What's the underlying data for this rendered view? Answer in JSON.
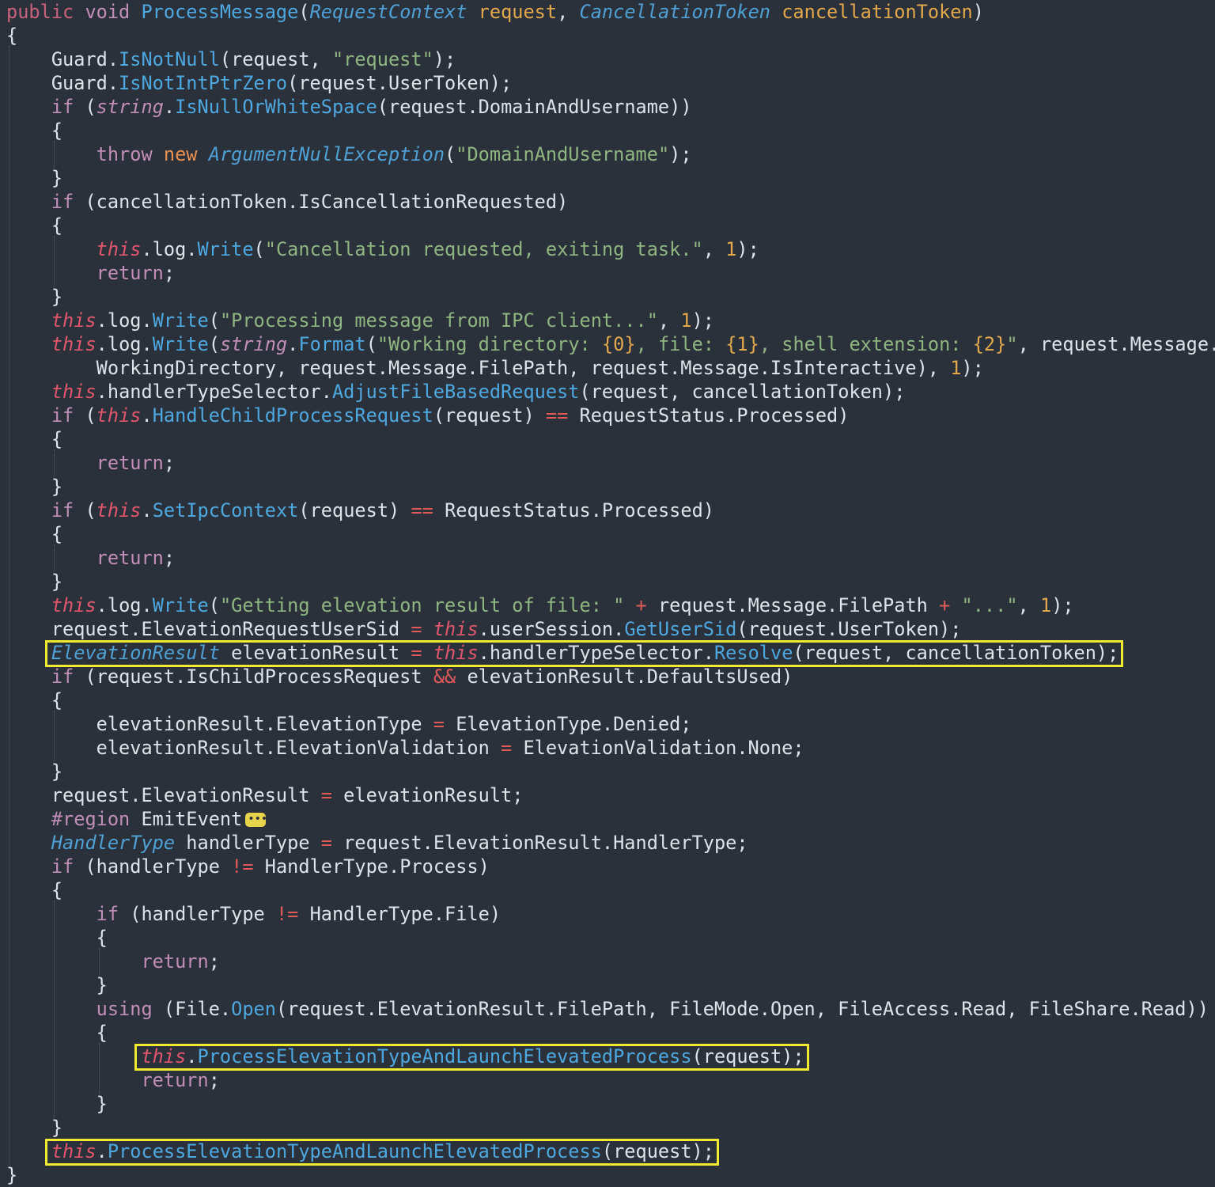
{
  "colors": {
    "background": "#2b313b",
    "text": "#dfe3e8",
    "keyword": "#c18eb8",
    "keyword_modifier": "#c9627a",
    "keyword_new": "#e89150",
    "type": "#4fa0d4",
    "method": "#4ea8e0",
    "string": "#8fb580",
    "number": "#e2a84c",
    "this": "#e0566c",
    "operator": "#e05a5a",
    "param": "#e2a84c",
    "highlight": "#f2ea2f"
  },
  "code_lines": [
    [
      [
        "public ",
        "keyword_modifier"
      ],
      [
        "void ",
        "keyword"
      ],
      [
        "ProcessMessage",
        "method"
      ],
      [
        "(",
        "text"
      ],
      [
        "RequestContext",
        "type_it"
      ],
      [
        " request, ",
        "param_mix"
      ],
      [
        "CancellationToken",
        "type_it"
      ],
      [
        " cancellationToken",
        "param"
      ],
      [
        ")",
        "text"
      ]
    ],
    [
      [
        "{",
        "text"
      ]
    ],
    [
      [
        "    Guard.",
        "text"
      ],
      [
        "IsNotNull",
        "method"
      ],
      [
        "(request, ",
        "text"
      ],
      [
        "\"request\"",
        "string"
      ],
      [
        ");",
        "text"
      ]
    ],
    [
      [
        "    Guard.",
        "text"
      ],
      [
        "IsNotIntPtrZero",
        "method"
      ],
      [
        "(request.UserToken);",
        "text"
      ]
    ],
    [
      [
        "    ",
        "text"
      ],
      [
        "if",
        "keyword"
      ],
      [
        " (",
        "text"
      ],
      [
        "string",
        "keyword_it"
      ],
      [
        ".",
        "text"
      ],
      [
        "IsNullOrWhiteSpace",
        "method"
      ],
      [
        "(request.DomainAndUsername))",
        "text"
      ]
    ],
    [
      [
        "    {",
        "text"
      ]
    ],
    [
      [
        "        ",
        "text"
      ],
      [
        "throw",
        "keyword"
      ],
      [
        " ",
        "text"
      ],
      [
        "new",
        "keyword_new"
      ],
      [
        " ",
        "text"
      ],
      [
        "ArgumentNullException",
        "type_it"
      ],
      [
        "(",
        "text"
      ],
      [
        "\"DomainAndUsername\"",
        "string"
      ],
      [
        ");",
        "text"
      ]
    ],
    [
      [
        "    }",
        "text"
      ]
    ],
    [
      [
        "    ",
        "text"
      ],
      [
        "if",
        "keyword"
      ],
      [
        " (cancellationToken.IsCancellationRequested)",
        "text"
      ]
    ],
    [
      [
        "    {",
        "text"
      ]
    ],
    [
      [
        "        ",
        "text"
      ],
      [
        "this",
        "this"
      ],
      [
        ".log.",
        "text"
      ],
      [
        "Write",
        "method"
      ],
      [
        "(",
        "text"
      ],
      [
        "\"Cancellation requested, exiting task.\"",
        "string"
      ],
      [
        ", ",
        "text"
      ],
      [
        "1",
        "number"
      ],
      [
        ");",
        "text"
      ]
    ],
    [
      [
        "        ",
        "text"
      ],
      [
        "return",
        "keyword"
      ],
      [
        ";",
        "text"
      ]
    ],
    [
      [
        "    }",
        "text"
      ]
    ],
    [
      [
        "    ",
        "text"
      ],
      [
        "this",
        "this"
      ],
      [
        ".log.",
        "text"
      ],
      [
        "Write",
        "method"
      ],
      [
        "(",
        "text"
      ],
      [
        "\"Processing message from IPC client...\"",
        "string"
      ],
      [
        ", ",
        "text"
      ],
      [
        "1",
        "number"
      ],
      [
        ");",
        "text"
      ]
    ],
    [
      [
        "    ",
        "text"
      ],
      [
        "this",
        "this"
      ],
      [
        ".log.",
        "text"
      ],
      [
        "Write",
        "method"
      ],
      [
        "(",
        "text"
      ],
      [
        "string",
        "keyword_it"
      ],
      [
        ".",
        "text"
      ],
      [
        "Format",
        "method"
      ],
      [
        "(",
        "text"
      ],
      [
        "\"Working directory: ",
        "string"
      ],
      [
        "{0}",
        "number"
      ],
      [
        ", file: ",
        "string"
      ],
      [
        "{1}",
        "number"
      ],
      [
        ", shell extension: ",
        "string"
      ],
      [
        "{2}",
        "number"
      ],
      [
        "\"",
        "string"
      ],
      [
        ", request.Message.",
        "text"
      ]
    ],
    [
      [
        "        WorkingDirectory, request.Message.FilePath, request.Message.IsInteractive), ",
        "text"
      ],
      [
        "1",
        "number"
      ],
      [
        ");",
        "text"
      ]
    ],
    [
      [
        "    ",
        "text"
      ],
      [
        "this",
        "this"
      ],
      [
        ".handlerTypeSelector.",
        "text"
      ],
      [
        "AdjustFileBasedRequest",
        "method"
      ],
      [
        "(request, cancellationToken);",
        "text"
      ]
    ],
    [
      [
        "    ",
        "text"
      ],
      [
        "if",
        "keyword"
      ],
      [
        " (",
        "text"
      ],
      [
        "this",
        "this"
      ],
      [
        ".",
        "text"
      ],
      [
        "HandleChildProcessRequest",
        "method"
      ],
      [
        "(request) ",
        "text"
      ],
      [
        "==",
        "operator"
      ],
      [
        " RequestStatus.Processed)",
        "text"
      ]
    ],
    [
      [
        "    {",
        "text"
      ]
    ],
    [
      [
        "        ",
        "text"
      ],
      [
        "return",
        "keyword"
      ],
      [
        ";",
        "text"
      ]
    ],
    [
      [
        "    }",
        "text"
      ]
    ],
    [
      [
        "    ",
        "text"
      ],
      [
        "if",
        "keyword"
      ],
      [
        " (",
        "text"
      ],
      [
        "this",
        "this"
      ],
      [
        ".",
        "text"
      ],
      [
        "SetIpcContext",
        "method"
      ],
      [
        "(request) ",
        "text"
      ],
      [
        "==",
        "operator"
      ],
      [
        " RequestStatus.Processed)",
        "text"
      ]
    ],
    [
      [
        "    {",
        "text"
      ]
    ],
    [
      [
        "        ",
        "text"
      ],
      [
        "return",
        "keyword"
      ],
      [
        ";",
        "text"
      ]
    ],
    [
      [
        "    }",
        "text"
      ]
    ],
    [
      [
        "    ",
        "text"
      ],
      [
        "this",
        "this"
      ],
      [
        ".log.",
        "text"
      ],
      [
        "Write",
        "method"
      ],
      [
        "(",
        "text"
      ],
      [
        "\"Getting elevation result of file: \"",
        "string"
      ],
      [
        " ",
        "text"
      ],
      [
        "+",
        "operator"
      ],
      [
        " request.Message.FilePath ",
        "text"
      ],
      [
        "+",
        "operator"
      ],
      [
        " ",
        "text"
      ],
      [
        "\"...\"",
        "string"
      ],
      [
        ", ",
        "text"
      ],
      [
        "1",
        "number"
      ],
      [
        ");",
        "text"
      ]
    ],
    [
      [
        "    request.ElevationRequestUserSid ",
        "text"
      ],
      [
        "=",
        "operator"
      ],
      [
        " ",
        "text"
      ],
      [
        "this",
        "this"
      ],
      [
        ".userSession.",
        "text"
      ],
      [
        "GetUserSid",
        "method"
      ],
      [
        "(request.UserToken);",
        "text"
      ]
    ],
    [
      [
        "    ",
        "text"
      ],
      [
        "ElevationResult",
        "type_it"
      ],
      [
        " elevationResult ",
        "text"
      ],
      [
        "=",
        "operator"
      ],
      [
        " ",
        "text"
      ],
      [
        "this",
        "this"
      ],
      [
        ".handlerTypeSelector.",
        "text"
      ],
      [
        "Resolve",
        "method"
      ],
      [
        "(request, cancellationToken);",
        "text"
      ]
    ],
    [
      [
        "    ",
        "text"
      ],
      [
        "if",
        "keyword"
      ],
      [
        " (request.IsChildProcessRequest ",
        "text"
      ],
      [
        "&&",
        "operator"
      ],
      [
        " elevationResult.DefaultsUsed)",
        "text"
      ]
    ],
    [
      [
        "    {",
        "text"
      ]
    ],
    [
      [
        "        elevationResult.ElevationType ",
        "text"
      ],
      [
        "=",
        "operator"
      ],
      [
        " ElevationType.Denied;",
        "text"
      ]
    ],
    [
      [
        "        elevationResult.ElevationValidation ",
        "text"
      ],
      [
        "=",
        "operator"
      ],
      [
        " ElevationValidation.None;",
        "text"
      ]
    ],
    [
      [
        "    }",
        "text"
      ]
    ],
    [
      [
        "    request.ElevationResult ",
        "text"
      ],
      [
        "=",
        "operator"
      ],
      [
        " elevationResult;",
        "text"
      ]
    ],
    [
      [
        "    ",
        "text"
      ],
      [
        "#region",
        "keyword"
      ],
      [
        " EmitEvent",
        "text"
      ],
      [
        "",
        "fold"
      ]
    ],
    [
      [
        "    ",
        "text"
      ],
      [
        "HandlerType",
        "type_it"
      ],
      [
        " handlerType ",
        "text"
      ],
      [
        "=",
        "operator"
      ],
      [
        " request.ElevationResult.HandlerType;",
        "text"
      ]
    ],
    [
      [
        "    ",
        "text"
      ],
      [
        "if",
        "keyword"
      ],
      [
        " (handlerType ",
        "text"
      ],
      [
        "!=",
        "operator"
      ],
      [
        " HandlerType.Process)",
        "text"
      ]
    ],
    [
      [
        "    {",
        "text"
      ]
    ],
    [
      [
        "        ",
        "text"
      ],
      [
        "if",
        "keyword"
      ],
      [
        " (handlerType ",
        "text"
      ],
      [
        "!=",
        "operator"
      ],
      [
        " HandlerType.File)",
        "text"
      ]
    ],
    [
      [
        "        {",
        "text"
      ]
    ],
    [
      [
        "            ",
        "text"
      ],
      [
        "return",
        "keyword"
      ],
      [
        ";",
        "text"
      ]
    ],
    [
      [
        "        }",
        "text"
      ]
    ],
    [
      [
        "        ",
        "text"
      ],
      [
        "using",
        "keyword"
      ],
      [
        " (File.",
        "text"
      ],
      [
        "Open",
        "method"
      ],
      [
        "(request.ElevationResult.FilePath, FileMode.Open, FileAccess.Read, FileShare.Read))",
        "text"
      ]
    ],
    [
      [
        "        {",
        "text"
      ]
    ],
    [
      [
        "            ",
        "text"
      ],
      [
        "this",
        "this"
      ],
      [
        ".",
        "text"
      ],
      [
        "ProcessElevationTypeAndLaunchElevatedProcess",
        "method"
      ],
      [
        "(request);",
        "text"
      ]
    ],
    [
      [
        "            ",
        "text"
      ],
      [
        "return",
        "keyword"
      ],
      [
        ";",
        "text"
      ]
    ],
    [
      [
        "        }",
        "text"
      ]
    ],
    [
      [
        "    }",
        "text"
      ]
    ],
    [
      [
        "    ",
        "text"
      ],
      [
        "this",
        "this"
      ],
      [
        ".",
        "text"
      ],
      [
        "ProcessElevationTypeAndLaunchElevatedProcess",
        "method"
      ],
      [
        "(request);",
        "text"
      ]
    ],
    [
      [
        "}",
        "text"
      ]
    ]
  ],
  "highlighted_lines": [
    27,
    44,
    48
  ],
  "fold_label": "collapsed-region"
}
